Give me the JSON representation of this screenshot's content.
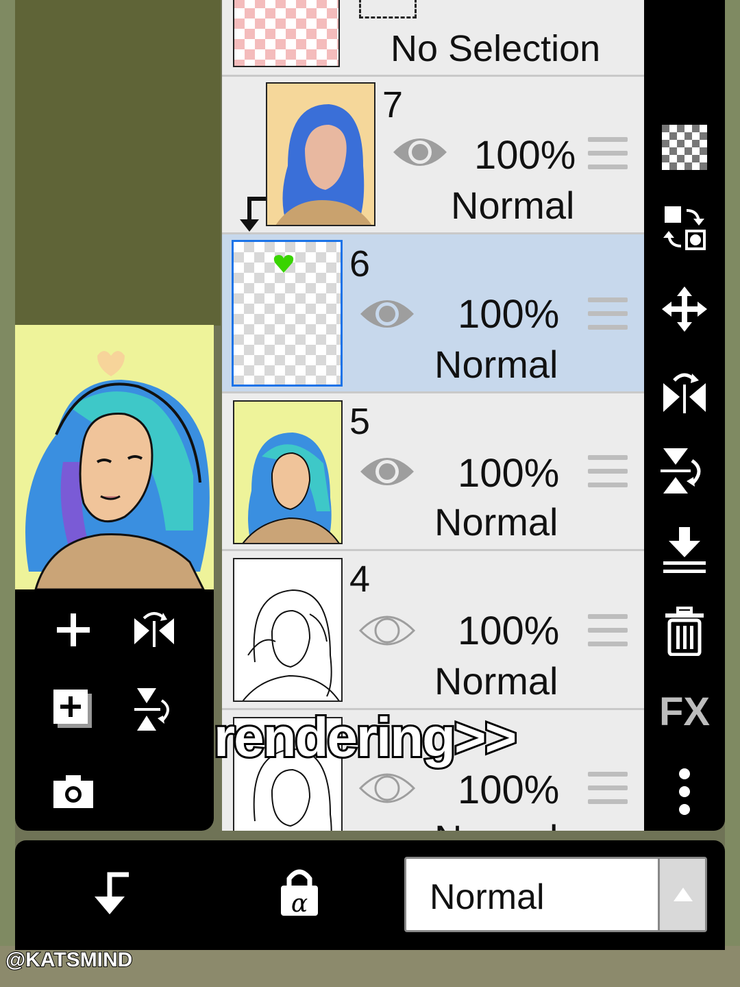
{
  "layers_panel": {
    "selection_row": {
      "label": "No Selection"
    },
    "layers": [
      {
        "number": "7",
        "opacity": "100%",
        "blend": "Normal",
        "visible": true,
        "clipped": true
      },
      {
        "number": "6",
        "opacity": "100%",
        "blend": "Normal",
        "visible": true,
        "selected": true
      },
      {
        "number": "5",
        "opacity": "100%",
        "blend": "Normal",
        "visible": true
      },
      {
        "number": "4",
        "opacity": "100%",
        "blend": "Normal",
        "visible": false
      },
      {
        "number": "",
        "opacity": "100%",
        "blend": "Normal",
        "visible": false
      }
    ]
  },
  "right_toolbar": {
    "fx_label": "FX"
  },
  "bottom_bar": {
    "blend_mode": "Normal"
  },
  "overlay": {
    "caption": "rendering>>",
    "watermark": "@KATSMIND"
  },
  "colors": {
    "selected_row": "#c7d8ec",
    "selected_border": "#1a73e8",
    "panel_bg": "#000000",
    "heart": "#39d400"
  }
}
